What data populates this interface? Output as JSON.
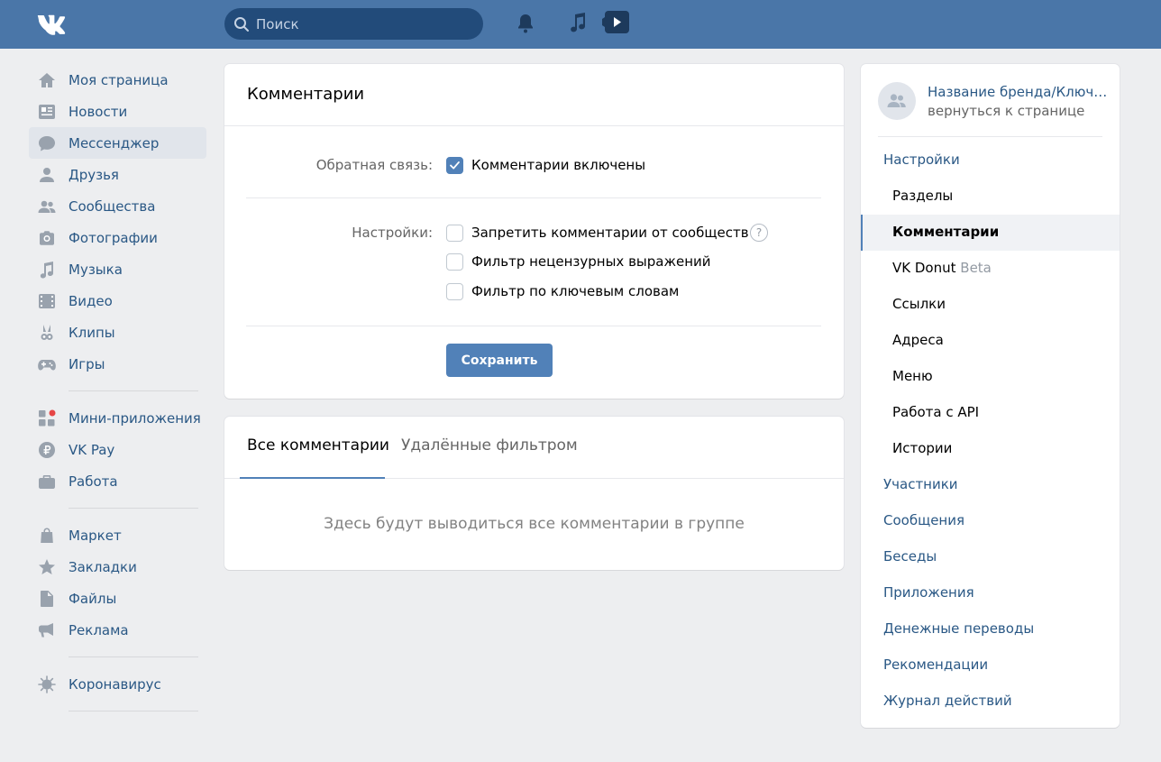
{
  "header": {
    "search_placeholder": "Поиск"
  },
  "left_nav": {
    "groups": [
      [
        {
          "label": "Моя страница",
          "icon": "home-icon"
        },
        {
          "label": "Новости",
          "icon": "news-icon"
        },
        {
          "label": "Мессенджер",
          "icon": "messenger-icon",
          "active": true
        },
        {
          "label": "Друзья",
          "icon": "friends-icon"
        },
        {
          "label": "Сообщества",
          "icon": "communities-icon"
        },
        {
          "label": "Фотографии",
          "icon": "camera-icon"
        },
        {
          "label": "Музыка",
          "icon": "music-icon"
        },
        {
          "label": "Видео",
          "icon": "video-icon"
        },
        {
          "label": "Клипы",
          "icon": "clips-icon"
        },
        {
          "label": "Игры",
          "icon": "gamepad-icon"
        }
      ],
      [
        {
          "label": "Мини-приложения",
          "icon": "apps-icon",
          "badge": true
        },
        {
          "label": "VK Pay",
          "icon": "vkpay-icon"
        },
        {
          "label": "Работа",
          "icon": "briefcase-icon"
        }
      ],
      [
        {
          "label": "Маркет",
          "icon": "bag-icon"
        },
        {
          "label": "Закладки",
          "icon": "star-icon"
        },
        {
          "label": "Файлы",
          "icon": "file-icon"
        },
        {
          "label": "Реклама",
          "icon": "megaphone-icon"
        }
      ],
      [
        {
          "label": "Коронавирус",
          "icon": "virus-icon"
        }
      ]
    ]
  },
  "comments_settings": {
    "title": "Комментарии",
    "feedback_label": "Обратная связь:",
    "feedback_option": "Комментарии включены",
    "feedback_checked": true,
    "settings_label": "Настройки:",
    "settings_options": [
      {
        "label": "Запретить комментарии от сообществ",
        "checked": false,
        "help": "?"
      },
      {
        "label": "Фильтр нецензурных выражений",
        "checked": false
      },
      {
        "label": "Фильтр по ключевым словам",
        "checked": false
      }
    ],
    "save_label": "Сохранить"
  },
  "comments_list": {
    "tabs": [
      {
        "label": "Все комментарии",
        "active": true
      },
      {
        "label": "Удалённые фильтром",
        "active": false
      }
    ],
    "empty_text": "Здесь будут выводиться все комментарии в группе"
  },
  "right_nav": {
    "brand_name": "Название бренда/Ключе...",
    "back_label": "вернуться к странице",
    "items": [
      {
        "label": "Настройки",
        "level": "top"
      },
      {
        "label": "Разделы",
        "level": "sub"
      },
      {
        "label": "Комментарии",
        "level": "sub",
        "active": true
      },
      {
        "label": "VK Donut",
        "level": "sub",
        "suffix": "Beta"
      },
      {
        "label": "Ссылки",
        "level": "sub"
      },
      {
        "label": "Адреса",
        "level": "sub"
      },
      {
        "label": "Меню",
        "level": "sub"
      },
      {
        "label": "Работа с API",
        "level": "sub"
      },
      {
        "label": "Истории",
        "level": "sub"
      },
      {
        "label": "Участники",
        "level": "top"
      },
      {
        "label": "Сообщения",
        "level": "top"
      },
      {
        "label": "Беседы",
        "level": "top"
      },
      {
        "label": "Приложения",
        "level": "top"
      },
      {
        "label": "Денежные переводы",
        "level": "top"
      },
      {
        "label": "Рекомендации",
        "level": "top"
      },
      {
        "label": "Журнал действий",
        "level": "top"
      }
    ]
  },
  "colors": {
    "header_bg": "#4a76a8",
    "accent": "#5181b8",
    "link": "#2a5885",
    "page_bg": "#edeef0"
  }
}
